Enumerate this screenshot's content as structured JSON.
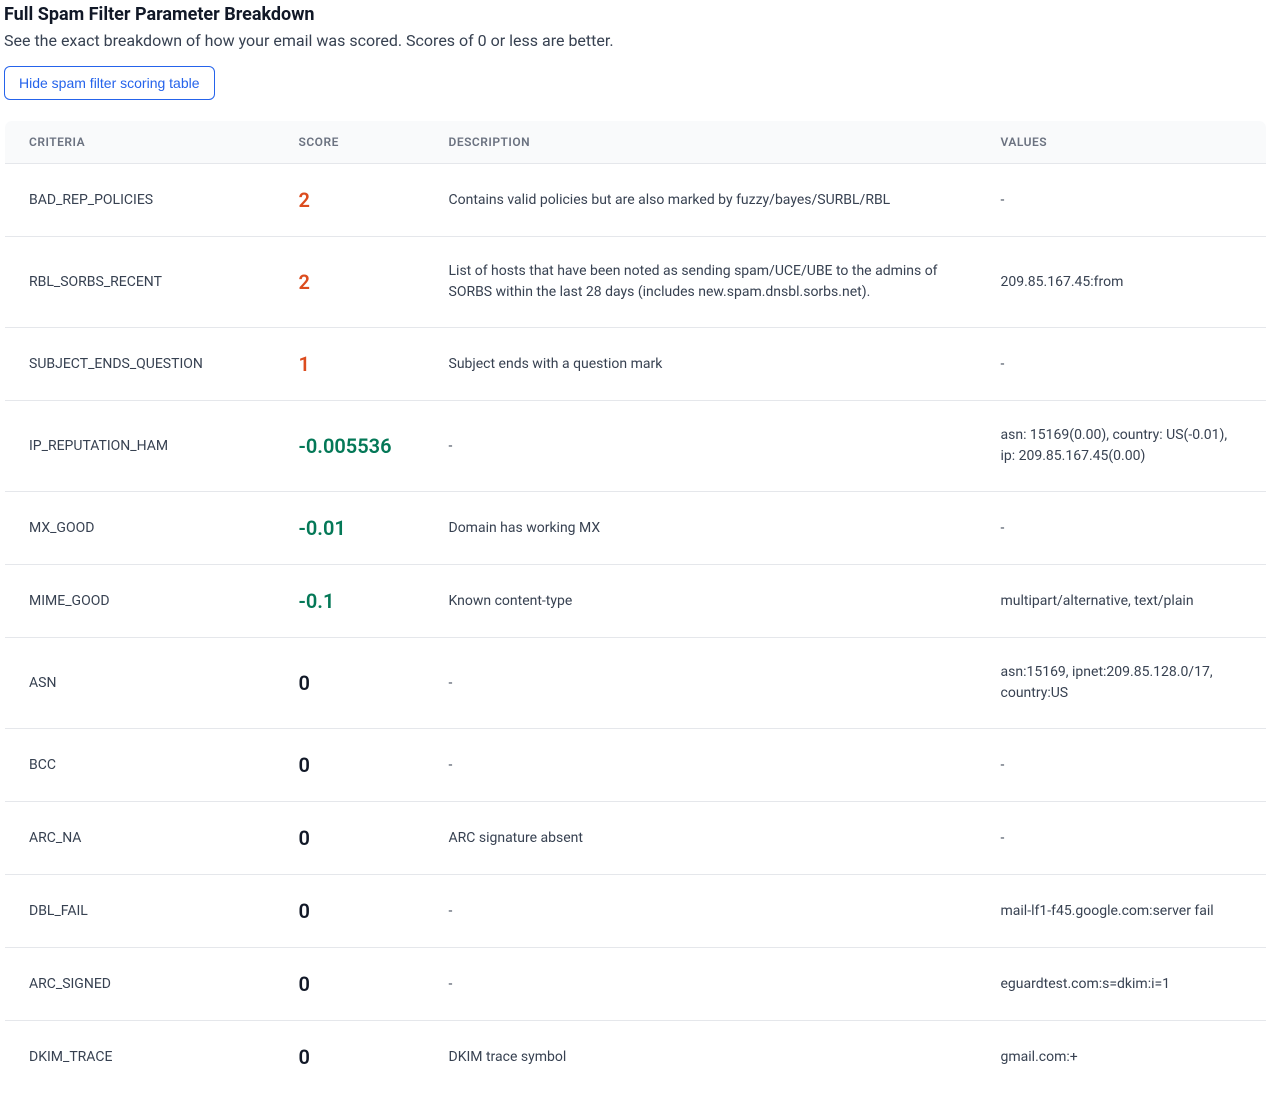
{
  "header": {
    "title": "Full Spam Filter Parameter Breakdown",
    "subtitle": "See the exact breakdown of how your email was scored. Scores of 0 or less are better.",
    "hide_button": "Hide spam filter scoring table"
  },
  "columns": {
    "criteria": "CRITERIA",
    "score": "SCORE",
    "description": "DESCRIPTION",
    "values": "VALUES"
  },
  "rows": [
    {
      "criteria": "BAD_REP_POLICIES",
      "score": "2",
      "score_class": "pos",
      "description": "Contains valid policies but are also marked by fuzzy/bayes/SURBL/RBL",
      "values": "-"
    },
    {
      "criteria": "RBL_SORBS_RECENT",
      "score": "2",
      "score_class": "pos",
      "description": "List of hosts that have been noted as sending spam/UCE/UBE to the admins of SORBS within the last 28 days (includes new.spam.dnsbl.sorbs.net).",
      "values": "209.85.167.45:from"
    },
    {
      "criteria": "SUBJECT_ENDS_QUESTION",
      "score": "1",
      "score_class": "pos",
      "description": "Subject ends with a question mark",
      "values": "-"
    },
    {
      "criteria": "IP_REPUTATION_HAM",
      "score": "-0.005536",
      "score_class": "neg",
      "description": "-",
      "values": "asn: 15169(0.00), country: US(-0.01), ip: 209.85.167.45(0.00)"
    },
    {
      "criteria": "MX_GOOD",
      "score": "-0.01",
      "score_class": "neg",
      "description": "Domain has working MX",
      "values": "-"
    },
    {
      "criteria": "MIME_GOOD",
      "score": "-0.1",
      "score_class": "neg",
      "description": "Known content-type",
      "values": "multipart/alternative, text/plain"
    },
    {
      "criteria": "ASN",
      "score": "0",
      "score_class": "zero",
      "description": "-",
      "values": "asn:15169, ipnet:209.85.128.0/17, country:US"
    },
    {
      "criteria": "BCC",
      "score": "0",
      "score_class": "zero",
      "description": "-",
      "values": "-"
    },
    {
      "criteria": "ARC_NA",
      "score": "0",
      "score_class": "zero",
      "description": "ARC signature absent",
      "values": "-"
    },
    {
      "criteria": "DBL_FAIL",
      "score": "0",
      "score_class": "zero",
      "description": "-",
      "values": "mail-lf1-f45.google.com:server fail"
    },
    {
      "criteria": "ARC_SIGNED",
      "score": "0",
      "score_class": "zero",
      "description": "-",
      "values": "eguardtest.com:s=dkim:i=1"
    },
    {
      "criteria": "DKIM_TRACE",
      "score": "0",
      "score_class": "zero",
      "description": "DKIM trace symbol",
      "values": "gmail.com:+"
    }
  ]
}
